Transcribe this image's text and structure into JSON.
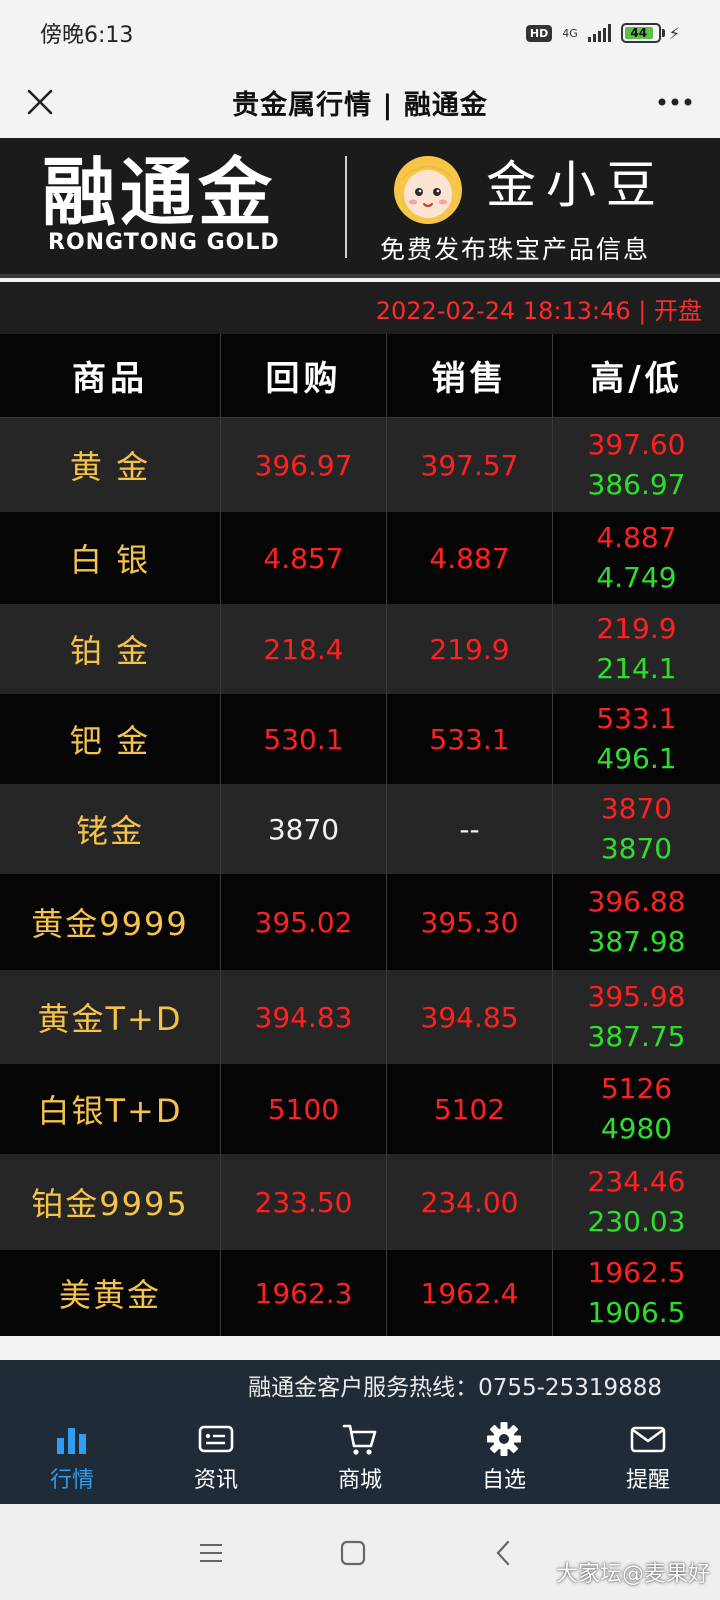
{
  "status_bar": {
    "time": "傍晚6:13",
    "hd": "HD",
    "network": "4G",
    "battery": "44"
  },
  "title_bar": {
    "title": "贵金属行情 | 融通金"
  },
  "banner": {
    "logo_cn": "融通金",
    "logo_en": "RONGTONG  GOLD",
    "brand": "金小豆",
    "tagline": "免费发布珠宝产品信息"
  },
  "timestamp": "2022-02-24 18:13:46 | 开盘",
  "table": {
    "headers": [
      "商品",
      "回购",
      "销售",
      "高/低"
    ],
    "rows": [
      {
        "name": "黄 金",
        "buy": "396.97",
        "sell": "397.57",
        "high": "397.60",
        "low": "386.97"
      },
      {
        "name": "白 银",
        "buy": "4.857",
        "sell": "4.887",
        "high": "4.887",
        "low": "4.749"
      },
      {
        "name": "铂 金",
        "buy": "218.4",
        "sell": "219.9",
        "high": "219.9",
        "low": "214.1"
      },
      {
        "name": "钯 金",
        "buy": "530.1",
        "sell": "533.1",
        "high": "533.1",
        "low": "496.1"
      },
      {
        "name": "铑金",
        "buy": "3870",
        "sell": "--",
        "high": "3870",
        "low": "3870",
        "neutral": true
      },
      {
        "name": "黄金9999",
        "buy": "395.02",
        "sell": "395.30",
        "high": "396.88",
        "low": "387.98"
      },
      {
        "name": "黄金T+D",
        "buy": "394.83",
        "sell": "394.85",
        "high": "395.98",
        "low": "387.75"
      },
      {
        "name": "白银T+D",
        "buy": "5100",
        "sell": "5102",
        "high": "5126",
        "low": "4980"
      },
      {
        "name": "铂金9995",
        "buy": "233.50",
        "sell": "234.00",
        "high": "234.46",
        "low": "230.03"
      },
      {
        "name": "美黄金",
        "buy": "1962.3",
        "sell": "1962.4",
        "high": "1962.5",
        "low": "1906.5"
      }
    ]
  },
  "hotline": "融通金客户服务热线：0755-25319888",
  "bottom_nav": [
    {
      "label": "行情",
      "icon": "bar-chart-icon",
      "active": true
    },
    {
      "label": "资讯",
      "icon": "news-card-icon"
    },
    {
      "label": "商城",
      "icon": "cart-icon"
    },
    {
      "label": "自选",
      "icon": "gear-icon"
    },
    {
      "label": "提醒",
      "icon": "mail-icon"
    }
  ],
  "watermark": "大家坛@麦果好",
  "colors": {
    "accent": "#2f9df2",
    "up": "#ff2020",
    "down": "#2ddf2d",
    "product": "#f5c34a"
  }
}
